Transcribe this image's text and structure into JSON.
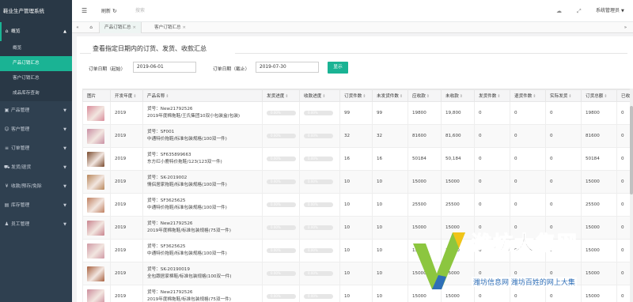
{
  "app_title": "鞋业生产管理系统",
  "sidebar": {
    "items": [
      {
        "label": "概览",
        "icon": "home-icon",
        "open": true,
        "sub": [
          "概览",
          "产品订销汇总",
          "客户订销汇总",
          "成品库存查询"
        ]
      },
      {
        "label": "产品管理",
        "icon": "cube-icon"
      },
      {
        "label": "客户管理",
        "icon": "user-icon"
      },
      {
        "label": "订单管理",
        "icon": "list-icon"
      },
      {
        "label": "发货/退货",
        "icon": "truck-icon"
      },
      {
        "label": "收款/预存/免除",
        "icon": "money-icon"
      },
      {
        "label": "库存管理",
        "icon": "warehouse-icon"
      },
      {
        "label": "员工管理",
        "icon": "people-icon"
      }
    ],
    "active_sub": "产品订销汇总"
  },
  "topbar": {
    "menu_icon": "hamburger-icon",
    "refresh": "刷新",
    "search_placeholder": "搜索",
    "user": "系统管理员"
  },
  "tabs": [
    {
      "label": "产品订销汇总",
      "active": true
    },
    {
      "label": "客户订销汇总",
      "active": false
    }
  ],
  "page": {
    "legend": "查看指定日期内的订货、发货、收款汇总",
    "start_label": "订单日期（起始）",
    "start_value": "2019-06-01",
    "end_label": "订单日期（截止）",
    "end_value": "2019-07-30",
    "show_button": "显示"
  },
  "table": {
    "columns": [
      "图片",
      "开发年度",
      "产品名称",
      "发货进度",
      "收款进度",
      "订货件数",
      "未发货件数",
      "应收款",
      "未收款",
      "发货件数",
      "退货件数",
      "实际发货",
      "订货总额",
      "已收"
    ],
    "rows": [
      {
        "thumb": "#d98b9a",
        "year": "2019",
        "code": "货号：New21792526",
        "name": "2019年度棉拖鞋/王氏集团10双小包装盒(包装)",
        "ship": "0.00%",
        "pay": "0.00%",
        "qty": "99",
        "unshipped": "99",
        "receivable": "19800",
        "unpaid": "19,800",
        "shipped": "0",
        "returned": "0",
        "actual": "0",
        "total": "19800",
        "paid": "0"
      },
      {
        "thumb": "#c98fa3",
        "year": "2019",
        "code": "货号：SF001",
        "name": "中通特价拖鞋/标准包装规格(100双一件)",
        "ship": "0.00%",
        "pay": "0.00%",
        "qty": "32",
        "unshipped": "32",
        "receivable": "81600",
        "unpaid": "81,600",
        "shipped": "0",
        "returned": "0",
        "actual": "0",
        "total": "81600",
        "paid": "0"
      },
      {
        "thumb": "#7a4b2e",
        "year": "2019",
        "code": "货号：SF635899663",
        "name": "东方红小鹿特价拖鞋/123(123双一件)",
        "ship": "0.00%",
        "pay": "0.00%",
        "qty": "16",
        "unshipped": "16",
        "receivable": "50184",
        "unpaid": "50,184",
        "shipped": "0",
        "returned": "0",
        "actual": "0",
        "total": "50184",
        "paid": "0"
      },
      {
        "thumb": "#b8865a",
        "year": "2019",
        "code": "货号：SK-2019002",
        "name": "情侣居家拖鞋/标准包装规格(100双一件)",
        "ship": "0.00%",
        "pay": "0.00%",
        "qty": "10",
        "unshipped": "10",
        "receivable": "15000",
        "unpaid": "15000",
        "shipped": "0",
        "returned": "0",
        "actual": "0",
        "total": "15000",
        "paid": "0"
      },
      {
        "thumb": "#c08060",
        "year": "2019",
        "code": "货号：SF3625625",
        "name": "中通特价拖鞋/标准包装规格(100双一件)",
        "ship": "0.00%",
        "pay": "0.00%",
        "qty": "10",
        "unshipped": "10",
        "receivable": "25500",
        "unpaid": "25500",
        "shipped": "0",
        "returned": "0",
        "actual": "0",
        "total": "25500",
        "paid": "0"
      },
      {
        "thumb": "#c9838e",
        "year": "2019",
        "code": "货号：New21792526",
        "name": "2019年度棉拖鞋/标准包装规格(75双一件)",
        "ship": "0.00%",
        "pay": "0.00%",
        "qty": "10",
        "unshipped": "10",
        "receivable": "15000",
        "unpaid": "15000",
        "shipped": "0",
        "returned": "0",
        "actual": "0",
        "total": "15000",
        "paid": "0"
      },
      {
        "thumb": "#d09aa5",
        "year": "2019",
        "code": "货号：SF3625625",
        "name": "中通特价拖鞋/标准包装规格(100双一件)",
        "ship": "0.00%",
        "pay": "0.00%",
        "qty": "10",
        "unshipped": "10",
        "receivable": "15000",
        "unpaid": "15000",
        "shipped": "0",
        "returned": "0",
        "actual": "0",
        "total": "15000",
        "paid": "0"
      },
      {
        "thumb": "#a8603f",
        "year": "2019",
        "code": "货号：SK-20190019",
        "name": "全包跟居家棉鞋/标准包装规格(100双一件)",
        "ship": "0.00%",
        "pay": "0.00%",
        "qty": "10",
        "unshipped": "10",
        "receivable": "15000",
        "unpaid": "15000",
        "shipped": "0",
        "returned": "0",
        "actual": "0",
        "total": "15000",
        "paid": "0"
      },
      {
        "thumb": "#cc8d9c",
        "year": "2019",
        "code": "货号：New21792526",
        "name": "2019年度棉拖鞋/标准包装规格(75双一件)",
        "ship": "0.00%",
        "pay": "0.00%",
        "qty": "10",
        "unshipped": "10",
        "receivable": "15000",
        "unpaid": "15000",
        "shipped": "0",
        "returned": "0",
        "actual": "0",
        "total": "15000",
        "paid": "0"
      }
    ]
  },
  "watermark": {
    "title": "潍坊大集网",
    "subtitle": "潍坊信息网 潍坊百姓的网上大集"
  },
  "colors": {
    "sidebar": "#2f4050",
    "accent": "#1ab394",
    "watermark_blue": "#2f6fb8"
  }
}
